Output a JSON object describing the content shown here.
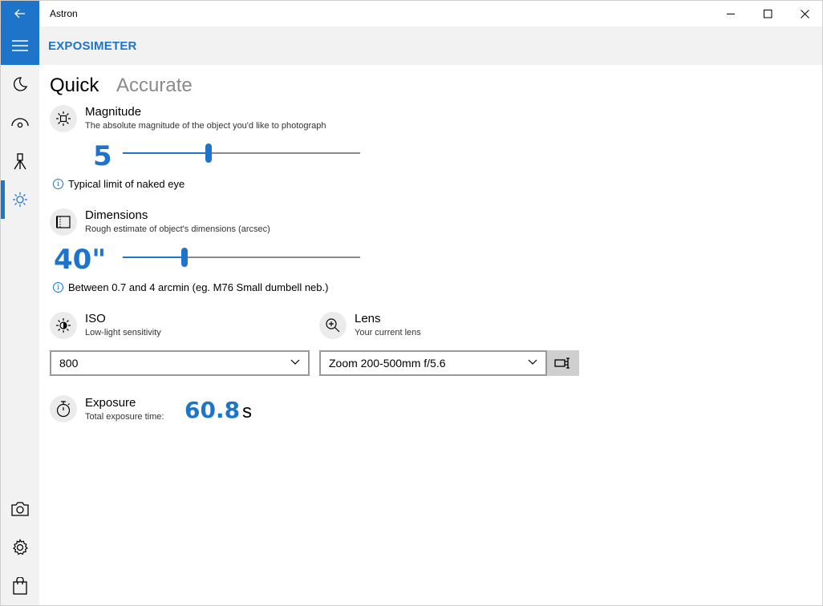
{
  "window": {
    "title": "Astron"
  },
  "header": {
    "page_title": "EXPOSIMETER"
  },
  "sidebar": {
    "items": [
      {
        "icon": "moon-icon"
      },
      {
        "icon": "eye-icon"
      },
      {
        "icon": "telescope-icon"
      },
      {
        "icon": "brightness-icon",
        "selected": true
      }
    ],
    "bottom_items": [
      {
        "icon": "camera-icon"
      },
      {
        "icon": "gear-icon"
      },
      {
        "icon": "shopping-bag-icon"
      }
    ]
  },
  "tabs": {
    "quick": "Quick",
    "accurate": "Accurate"
  },
  "magnitude": {
    "title": "Magnitude",
    "subtitle": "The absolute magnitude of the object you'd like to photograph",
    "value": "5",
    "slider_fraction": 0.36,
    "info": "Typical limit of naked eye"
  },
  "dimensions": {
    "title": "Dimensions",
    "subtitle": "Rough estimate of object's dimensions (arcsec)",
    "value": "40\"",
    "slider_fraction": 0.26,
    "info": "Between 0.7 and 4 arcmin (eg. M76 Small dumbell neb.)"
  },
  "iso": {
    "title": "ISO",
    "subtitle": "Low-light sensitivity",
    "selected": "800"
  },
  "lens": {
    "title": "Lens",
    "subtitle": "Your current lens",
    "selected": "Zoom 200-500mm f/5.6"
  },
  "exposure": {
    "title": "Exposure",
    "subtitle": "Total exposure time:",
    "value": "60.8",
    "unit": "s"
  },
  "colors": {
    "accent": "#1e74c8",
    "sidebar_bg": "#f2f2f2",
    "icon_circle": "#ebebeb"
  }
}
